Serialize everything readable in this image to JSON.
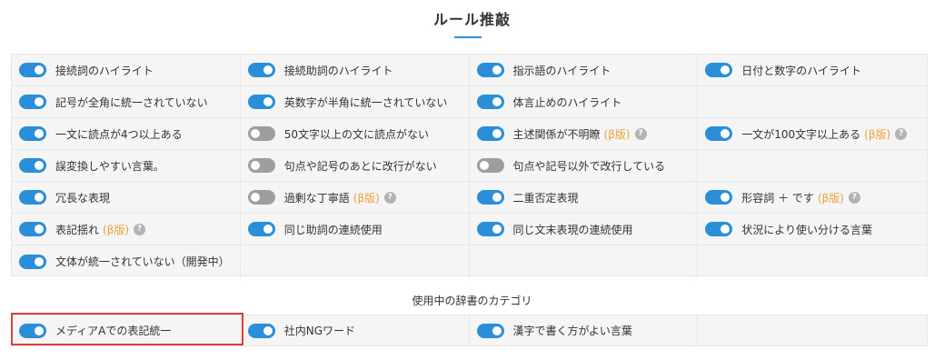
{
  "page": {
    "title": "ルール推敲"
  },
  "rules": [
    {
      "label": "接続詞のハイライト",
      "on": true
    },
    {
      "label": "接続助詞のハイライト",
      "on": true
    },
    {
      "label": "指示語のハイライト",
      "on": true
    },
    {
      "label": "日付と数字のハイライト",
      "on": true
    },
    {
      "label": "記号が全角に統一されていない",
      "on": true
    },
    {
      "label": "英数字が半角に統一されていない",
      "on": true
    },
    {
      "label": "体言止めのハイライト",
      "on": true
    },
    null,
    {
      "label": "一文に読点が4つ以上ある",
      "on": true
    },
    {
      "label": "50文字以上の文に読点がない",
      "on": false
    },
    {
      "label": "主述関係が不明瞭",
      "on": true,
      "beta": "(β版)",
      "help": true
    },
    {
      "label": "一文が100文字以上ある",
      "on": true,
      "beta": "(β版)",
      "help": true
    },
    {
      "label": "誤変換しやすい言葉。",
      "on": true
    },
    {
      "label": "句点や記号のあとに改行がない",
      "on": false
    },
    {
      "label": "句点や記号以外で改行している",
      "on": false
    },
    null,
    {
      "label": "冗長な表現",
      "on": true
    },
    {
      "label": "過剰な丁寧語",
      "on": false,
      "beta": "(β版)",
      "help": true
    },
    {
      "label": "二重否定表現",
      "on": true
    },
    {
      "label": "形容詞 ＋ です",
      "on": true,
      "beta": "(β版)",
      "help": true
    },
    {
      "label": "表記揺れ",
      "on": true,
      "beta": "(β版)",
      "help": true
    },
    {
      "label": "同じ助詞の連続使用",
      "on": true
    },
    {
      "label": "同じ文末表現の連続使用",
      "on": true
    },
    {
      "label": "状況により使い分ける言葉",
      "on": true
    },
    {
      "label": "文体が統一されていない（開発中）",
      "on": true
    },
    null,
    null,
    null
  ],
  "dictionary": {
    "heading": "使用中の辞書のカテゴリ",
    "items": [
      {
        "label": "メディアAでの表記統一",
        "on": true
      },
      {
        "label": "社内NGワード",
        "on": true
      },
      {
        "label": "漢字で書く方がよい言葉",
        "on": true
      },
      null
    ]
  },
  "colors": {
    "accent": "#2a8fd8",
    "toggle_off": "#9e9e9e",
    "beta": "#e9a23b",
    "highlight": "#d9403a"
  },
  "icons": {
    "help": "question-circle-icon"
  },
  "help_glyph": "?"
}
